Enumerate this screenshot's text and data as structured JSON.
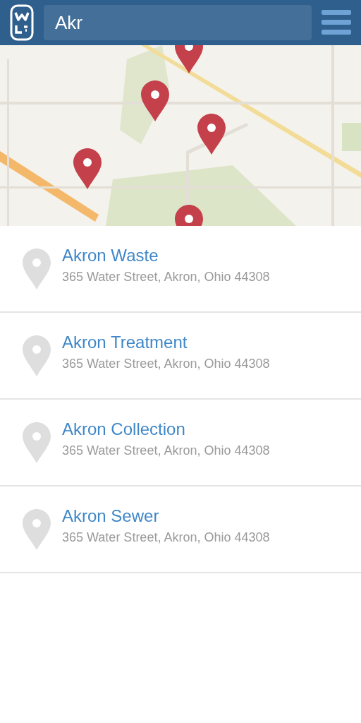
{
  "search": {
    "value": "Akr"
  },
  "results": [
    {
      "name": "Akron Waste",
      "address": "365 Water Street, Akron, Ohio 44308"
    },
    {
      "name": "Akron Treatment",
      "address": "365 Water Street, Akron, Ohio 44308"
    },
    {
      "name": "Akron Collection",
      "address": "365 Water Street, Akron, Ohio 44308"
    },
    {
      "name": "Akron Sewer",
      "address": "365 Water Street, Akron, Ohio 44308"
    }
  ]
}
